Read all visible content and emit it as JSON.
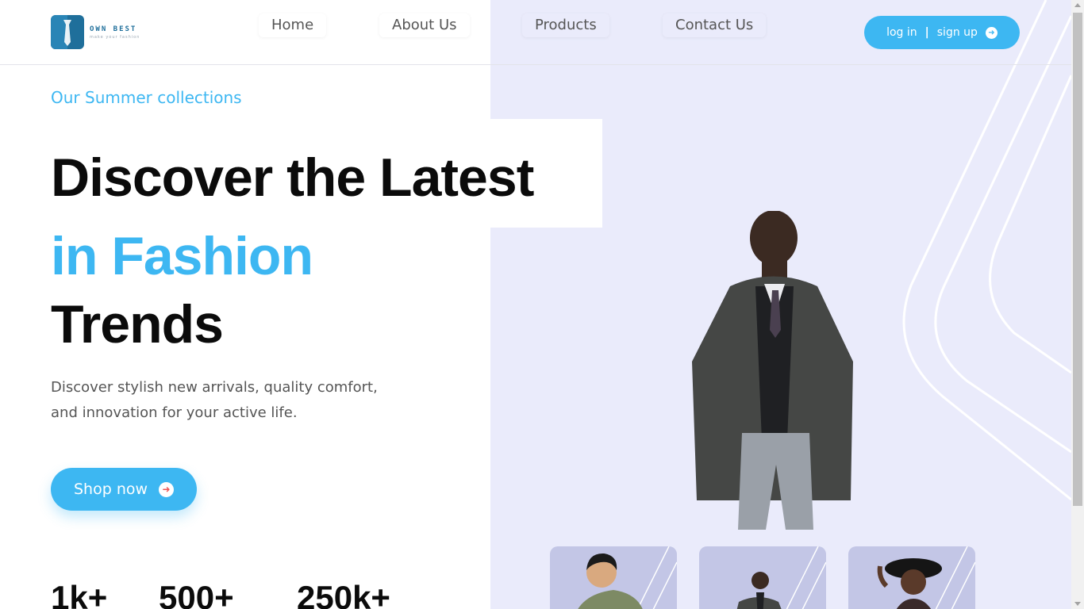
{
  "colors": {
    "accent": "#3db7f2",
    "panel": "#eaebfb",
    "thumb_bg": "#c3c6e6",
    "logo": "#1f6f9b"
  },
  "brand": {
    "name": "OWN BEST",
    "tagline": "make your fashion"
  },
  "nav": {
    "items": [
      {
        "label": "Home"
      },
      {
        "label": "About Us"
      },
      {
        "label": "Products"
      },
      {
        "label": "Contact Us"
      }
    ]
  },
  "auth": {
    "login": "log in",
    "separator": "|",
    "signup": "sign up",
    "icon": "arrow-right-circle-icon"
  },
  "hero": {
    "eyebrow": "Our Summer collections",
    "title_line1": "Discover the Latest",
    "title_line2": "in Fashion",
    "title_line3": "Trends",
    "description": "Discover stylish new arrivals, quality comfort, and innovation for your active life.",
    "cta": "Shop now",
    "cta_icon": "arrow-right-circle-icon",
    "image": "man-in-grey-coat-photo"
  },
  "stats": [
    {
      "value": "1k+"
    },
    {
      "value": "500+"
    },
    {
      "value": "250k+"
    }
  ],
  "thumbnails": [
    {
      "image": "child-in-green-sweater-photo"
    },
    {
      "image": "man-in-coat-photo"
    },
    {
      "image": "woman-in-black-hat-photo"
    }
  ]
}
